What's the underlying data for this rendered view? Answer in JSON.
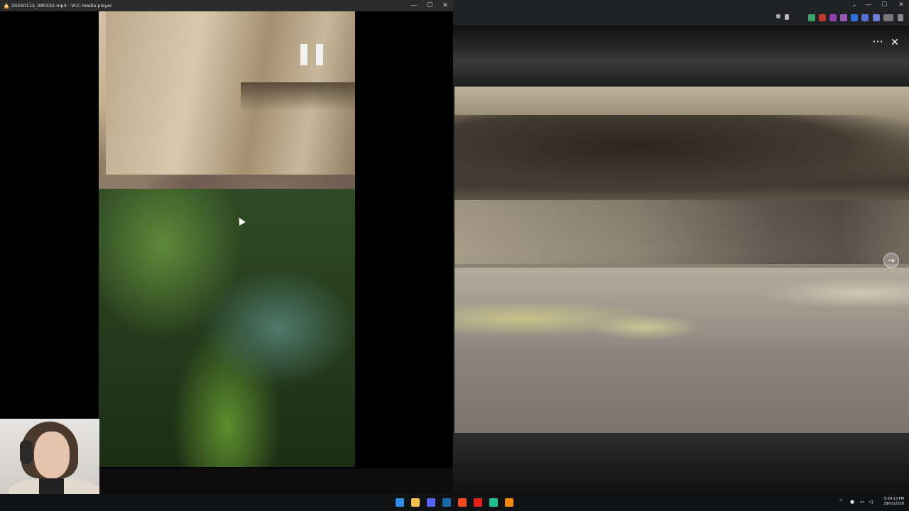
{
  "vlc": {
    "title": "20250115_080332.mp4 - VLC media player",
    "state": "paused",
    "logo": "vlc-cone-icon",
    "controls": {
      "minimize": "—",
      "maximize": "☐",
      "close": "✕"
    }
  },
  "viewer": {
    "more_label": "···",
    "close_label": "✕",
    "next_label": "→",
    "browser_controls": {
      "dropdown": "⌄",
      "minimize": "—",
      "maximize": "☐",
      "close": "✕"
    }
  },
  "taskbar": {
    "time": "5:09:13 PM",
    "date": "29/03/2026",
    "apps": [
      {
        "name": "windows-start-icon",
        "color": "#2f8fe6"
      },
      {
        "name": "file-explorer-icon",
        "color": "#f2c04a"
      },
      {
        "name": "discord-icon",
        "color": "#5865f2"
      },
      {
        "name": "steam-icon",
        "color": "#1b6aa5"
      },
      {
        "name": "brave-icon",
        "color": "#f04a23"
      },
      {
        "name": "youtube-music-icon",
        "color": "#e62117"
      },
      {
        "name": "app-icon",
        "color": "#1fbf8f"
      },
      {
        "name": "vlc-icon",
        "color": "#f28a0c"
      }
    ],
    "tray": [
      {
        "name": "chevron-up-icon",
        "glyph": "^"
      },
      {
        "name": "microphone-icon",
        "glyph": "●"
      },
      {
        "name": "network-icon",
        "glyph": "▭"
      },
      {
        "name": "speaker-icon",
        "glyph": "◁"
      }
    ]
  }
}
